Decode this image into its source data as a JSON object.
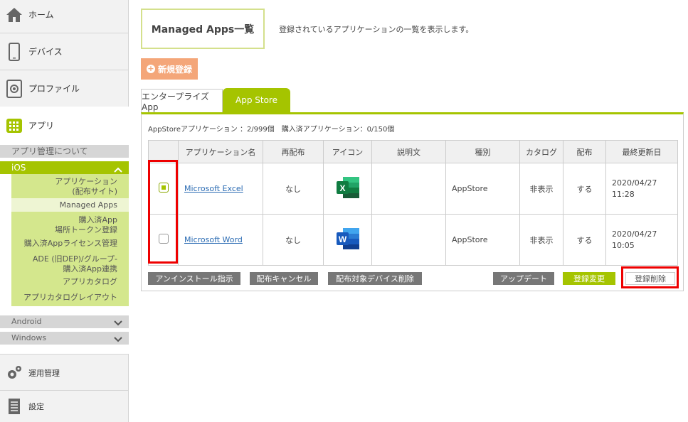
{
  "sidebar": {
    "home": "ホーム",
    "device": "デバイス",
    "profile": "プロファイル",
    "app": "アプリ",
    "about": "アプリ管理について",
    "ios": "iOS",
    "ios_items": [
      "アプリケーション\n(配布サイト)",
      "Managed Apps",
      "購入済App\n場所トークン登録",
      "購入済Appライセンス管理",
      "ADE (旧DEP)/グループ-\n購入済App連携",
      "アプリカタログ",
      "アプリカタログレイアウト"
    ],
    "android": "Android",
    "windows": "Windows",
    "ops": "運用管理",
    "settings": "設定"
  },
  "title": "Managed Apps一覧",
  "description": "登録されているアプリケーションの一覧を表示します。",
  "new_button": "新規登録",
  "tabs": [
    "エンタープライズApp",
    "App Store"
  ],
  "counts": "AppStoreアプリケーション ：2/999個　購入済アプリケーション：0/150個",
  "columns": [
    "",
    "アプリケーション名",
    "再配布",
    "アイコン",
    "説明文",
    "種別",
    "カタログ",
    "配布",
    "最終更新日"
  ],
  "rows": [
    {
      "name": "Microsoft Excel",
      "redistribute": "なし",
      "description": "",
      "type": "AppStore",
      "catalog": "非表示",
      "deploy": "する",
      "date": "2020/04/27",
      "time": "11:28",
      "checked": true
    },
    {
      "name": "Microsoft Word",
      "redistribute": "なし",
      "description": "",
      "type": "AppStore",
      "catalog": "非表示",
      "deploy": "する",
      "date": "2020/04/27",
      "time": "10:05",
      "checked": false
    }
  ],
  "actions": {
    "uninstall": "アンインストール指示",
    "cancel": "配布キャンセル",
    "delete_devices": "配布対象デバイス削除",
    "update": "アップデート",
    "edit": "登録変更",
    "delete": "登録削除"
  }
}
